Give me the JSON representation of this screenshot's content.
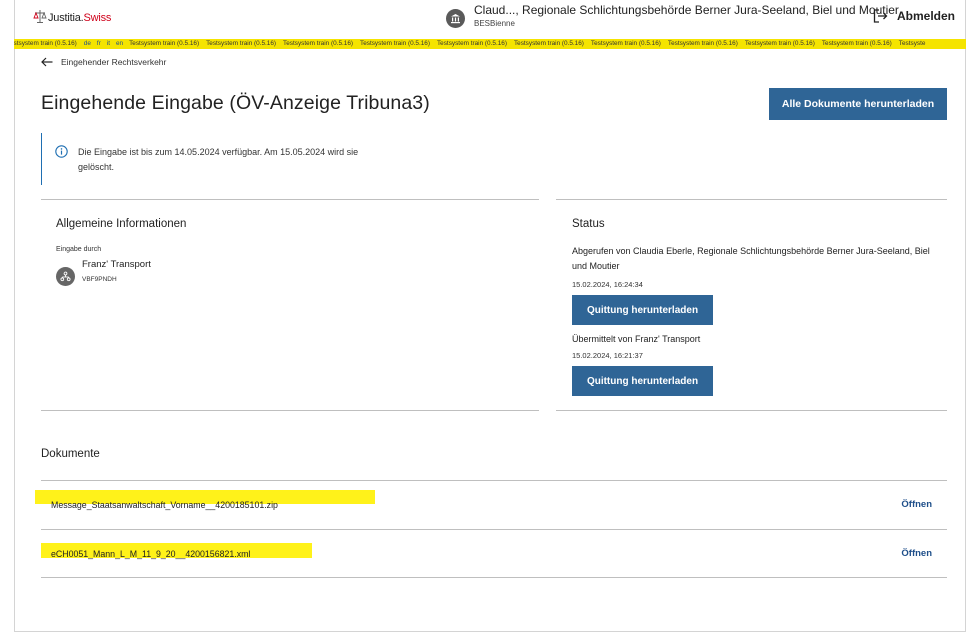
{
  "header": {
    "logo_text_main": "Justitia.",
    "logo_text_swiss": "Swiss",
    "user_name": "Claud..., Regionale Schlichtungsbehörde Berner Jura-Seeland, Biel und Moutier",
    "user_org": "BESBienne",
    "logout_label": "Abmelden"
  },
  "banner": {
    "lead": "estsystem train (0.5.16)",
    "languages": [
      "de",
      "fr",
      "it",
      "en"
    ],
    "repeat_text": "Testsystem train (0.5.16)",
    "tail": "Testsyste"
  },
  "nav": {
    "back_label": "Eingehender Rechtsverkehr"
  },
  "page": {
    "title": "Eingehende Eingabe (ÖV-Anzeige Tribuna3)",
    "download_all_label": "Alle Dokumente herunterladen"
  },
  "info": {
    "text": "Die Eingabe ist bis zum 14.05.2024 verfügbar. Am 15.05.2024 wird sie gelöscht."
  },
  "general": {
    "title": "Allgemeine Informationen",
    "submitted_by_label": "Eingabe durch",
    "org_name": "Franz' Transport",
    "org_id": "VBF9PNDH"
  },
  "status": {
    "title": "Status",
    "retrieved_text": "Abgerufen von Claudia Eberle, Regionale Schlichtungsbehörde Berner Jura-Seeland, Biel und Moutier",
    "retrieved_date": "15.02.2024, 16:24:34",
    "receipt_button_1": "Quittung herunterladen",
    "sent_text": "Übermittelt von Franz' Transport",
    "sent_date": "15.02.2024, 16:21:37",
    "receipt_button_2": "Quittung herunterladen"
  },
  "documents": {
    "title": "Dokumente",
    "items": [
      {
        "name": "Message_Staatsanwaltschaft_Vorname__4200185101.zip",
        "action": "Öffnen"
      },
      {
        "name": "eCH0051_Mann_L_M_11_9_20__4200156821.xml",
        "action": "Öffnen"
      }
    ]
  },
  "colors": {
    "primary_button": "#2f6596",
    "link": "#1f4f8a",
    "banner": "#f5e400",
    "highlight": "#fff21a",
    "info_border": "#1f6fb2",
    "logo_red": "#d0021b"
  }
}
